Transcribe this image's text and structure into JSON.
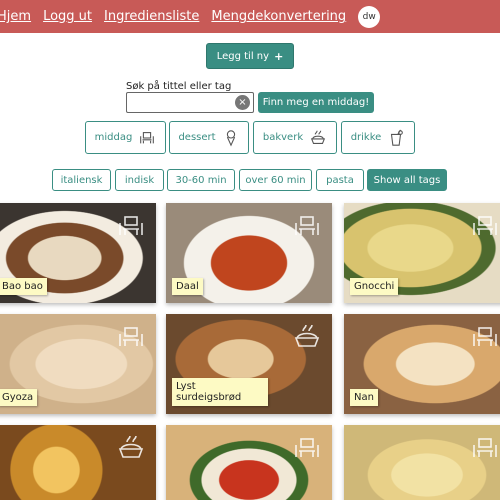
{
  "nav": {
    "links": [
      "Hjem",
      "Logg ut",
      "Ingrediensliste",
      "Mengdekonvertering"
    ],
    "avatar": "dw",
    "bg_color": "#c85a57"
  },
  "actions": {
    "add_label": "Legg til ny",
    "add_icon": "plus-icon"
  },
  "search": {
    "label": "Søk på tittel eller tag",
    "value": "",
    "placeholder": "",
    "clear_icon": "clear-icon",
    "find_label": "Finn meg en middag!"
  },
  "categories": [
    {
      "label": "middag",
      "icon": "dining-icon"
    },
    {
      "label": "dessert",
      "icon": "ice-cream-icon"
    },
    {
      "label": "bakverk",
      "icon": "pie-icon"
    },
    {
      "label": "drikke",
      "icon": "drink-icon"
    }
  ],
  "tags": [
    "italiensk",
    "indisk",
    "30-60 min",
    "over 60 min",
    "pasta",
    "Show all tags"
  ],
  "recipes": [
    {
      "title": "Bao bao",
      "icon": "dining-icon"
    },
    {
      "title": "Daal",
      "icon": "dining-icon"
    },
    {
      "title": "Gnocchi",
      "icon": "dining-icon"
    },
    {
      "title": "Gyoza",
      "icon": "dining-icon"
    },
    {
      "title": "Lyst surdeigsbrød",
      "icon": "pie-icon"
    },
    {
      "title": "Nan",
      "icon": "dining-icon"
    },
    {
      "title": "",
      "icon": "pie-icon"
    },
    {
      "title": "",
      "icon": "dining-icon"
    },
    {
      "title": "",
      "icon": "dining-icon"
    }
  ],
  "colors": {
    "accent": "#3a8e83",
    "label_bg": "#fdfac4"
  }
}
